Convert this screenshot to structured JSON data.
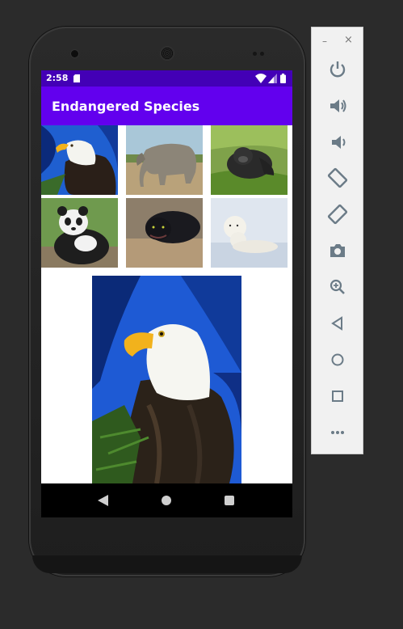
{
  "status_bar": {
    "time": "2:58"
  },
  "app_bar": {
    "title": "Endangered Species"
  },
  "gallery": {
    "thumbnails": [
      {
        "icon": "bald-eagle"
      },
      {
        "icon": "elephant"
      },
      {
        "icon": "gorilla"
      },
      {
        "icon": "panda"
      },
      {
        "icon": "black-panther"
      },
      {
        "icon": "polar-bears"
      }
    ],
    "selected": {
      "icon": "bald-eagle"
    }
  },
  "nav_bar": {
    "icons": [
      "back-icon",
      "home-icon",
      "recents-icon"
    ]
  },
  "emulator_toolbar": {
    "minimize": "–",
    "close": "×",
    "icons": [
      "power-icon",
      "volume-up-icon",
      "volume-down-icon",
      "rotate-left-icon",
      "rotate-right-icon",
      "camera-icon",
      "zoom-icon",
      "back-icon",
      "home-icon",
      "overview-icon",
      "more-icon"
    ]
  },
  "colors": {
    "status_bar": "#4300b6",
    "app_bar": "#6200ee",
    "desktop": "#2b2b2b"
  }
}
